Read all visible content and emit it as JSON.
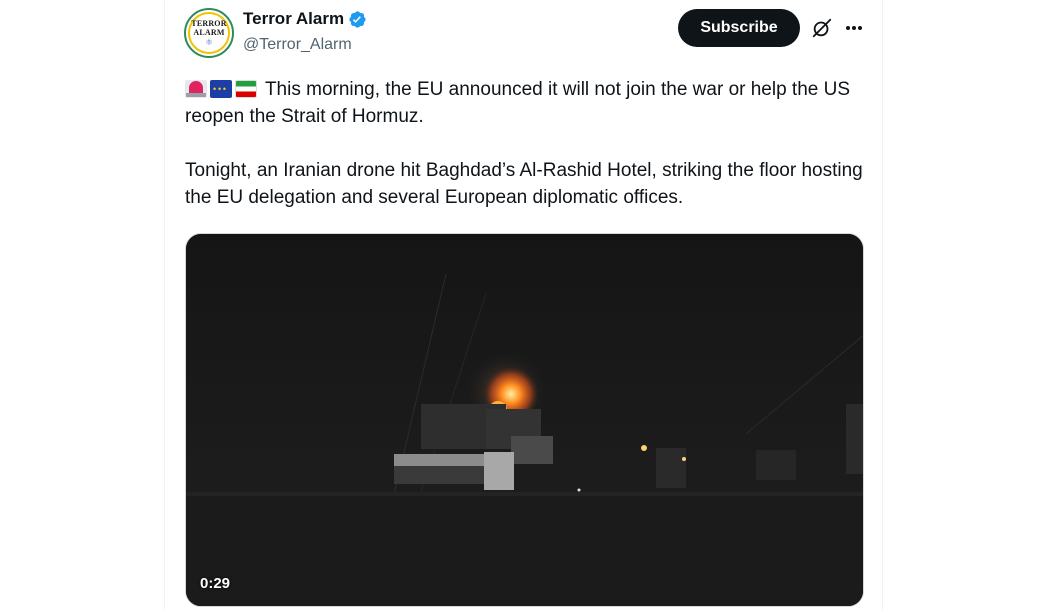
{
  "author": {
    "name": "Terror Alarm",
    "handle": "@Terror_Alarm",
    "avatar_line1": "TERROR",
    "avatar_line2": "ALARM",
    "verified": true
  },
  "actions": {
    "subscribe_label": "Subscribe",
    "grok_icon": "grok-icon",
    "more_icon": "more-icon"
  },
  "tweet": {
    "emojis": [
      "siren",
      "eu-flag",
      "iran-flag"
    ],
    "paragraph1": "This morning, the EU announced it will not join the war or help the US reopen the Strait of Hormuz.",
    "paragraph2": "Tonight, an Iranian drone hit Baghdad’s Al-Rashid Hotel, striking the floor hosting the EU delegation and several European diplomatic offices."
  },
  "media": {
    "type": "video",
    "duration": "0:29"
  },
  "colors": {
    "text": "#0f1419",
    "secondary": "#536471",
    "verified": "#1d9bf0",
    "subscribe_bg": "#0f1419"
  }
}
